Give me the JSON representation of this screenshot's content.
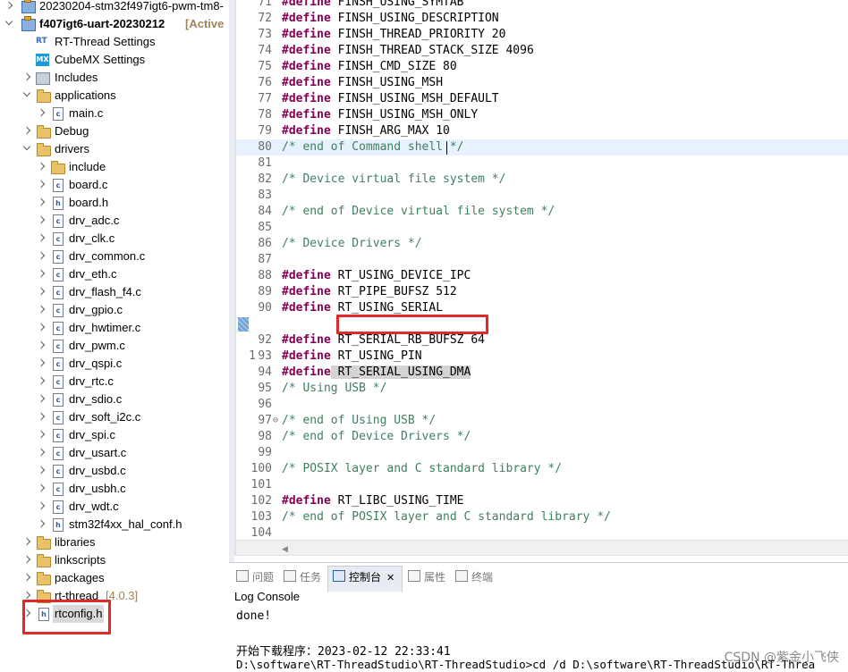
{
  "tree": {
    "project1": {
      "name": "20230204-stm32f497igt6-pwm-tm8-"
    },
    "project2": {
      "name": "f407igt6-uart-20230212",
      "status": "[Active"
    },
    "rtthread_settings": "RT-Thread Settings",
    "cubemx_settings": "CubeMX Settings",
    "includes": "Includes",
    "applications": "applications",
    "main_c": "main.c",
    "debug": "Debug",
    "drivers": "drivers",
    "driver_files": [
      "include",
      "board.c",
      "board.h",
      "drv_adc.c",
      "drv_clk.c",
      "drv_common.c",
      "drv_eth.c",
      "drv_flash_f4.c",
      "drv_gpio.c",
      "drv_hwtimer.c",
      "drv_pwm.c",
      "drv_qspi.c",
      "drv_rtc.c",
      "drv_sdio.c",
      "drv_soft_i2c.c",
      "drv_spi.c",
      "drv_usart.c",
      "drv_usbd.c",
      "drv_usbh.c",
      "drv_wdt.c",
      "stm32f4xx_hal_conf.h"
    ],
    "libraries": "libraries",
    "linkscripts": "linkscripts",
    "packages": "packages",
    "rtthread": "rt-thread",
    "rtthread_version": "[4.0.3]",
    "rtconfig": "rtconfig.h"
  },
  "editor": {
    "lines": [
      {
        "n": "71",
        "kw": "#define",
        "rest": " FINSH_USING_SYMTAB"
      },
      {
        "n": "72",
        "kw": "#define",
        "rest": " FINSH_USING_DESCRIPTION"
      },
      {
        "n": "73",
        "kw": "#define",
        "rest": " FINSH_THREAD_PRIORITY 20"
      },
      {
        "n": "74",
        "kw": "#define",
        "rest": " FINSH_THREAD_STACK_SIZE 4096"
      },
      {
        "n": "75",
        "kw": "#define",
        "rest": " FINSH_CMD_SIZE 80"
      },
      {
        "n": "76",
        "kw": "#define",
        "rest": " FINSH_USING_MSH"
      },
      {
        "n": "77",
        "kw": "#define",
        "rest": " FINSH_USING_MSH_DEFAULT"
      },
      {
        "n": "78",
        "kw": "#define",
        "rest": " FINSH_USING_MSH_ONLY"
      },
      {
        "n": "79",
        "kw": "#define",
        "rest": " FINSH_ARG_MAX 10"
      },
      {
        "n": "80",
        "comment": "/* end of Command shell */"
      },
      {
        "n": "81"
      },
      {
        "n": "82",
        "comment": "/* Device virtual file system */"
      },
      {
        "n": "83"
      },
      {
        "n": "84",
        "comment": "/* end of Device virtual file system */"
      },
      {
        "n": "85"
      },
      {
        "n": "86",
        "comment": "/* Device Drivers */"
      },
      {
        "n": "87"
      },
      {
        "n": "88",
        "kw": "#define",
        "rest": " RT_USING_DEVICE_IPC"
      },
      {
        "n": "89",
        "kw": "#define",
        "rest": " RT_PIPE_BUFSZ 512"
      },
      {
        "n": "90",
        "kw": "#define",
        "rest": " RT_USING_SERIAL"
      },
      {
        "n": "1",
        "kw": "#define",
        "rest": " RT_SERIAL_USING_DMA"
      },
      {
        "n": "92",
        "kw": "#define",
        "rest": " RT_SERIAL_RB_BUFSZ 64"
      },
      {
        "n": "93",
        "kw": "#define",
        "rest": " RT_USING_PIN"
      },
      {
        "n": "94"
      },
      {
        "n": "95",
        "comment": "/* Using USB */"
      },
      {
        "n": "96"
      },
      {
        "n": "97",
        "comment": "/* end of Using USB */"
      },
      {
        "n": "98",
        "comment": "/* end of Device Drivers */"
      },
      {
        "n": "99"
      },
      {
        "n": "100",
        "comment": "/* POSIX layer and C standard library */"
      },
      {
        "n": "101"
      },
      {
        "n": "102",
        "kw": "#define",
        "rest": " RT_LIBC_USING_TIME"
      },
      {
        "n": "103",
        "comment": "/* end of POSIX layer and C standard library */"
      },
      {
        "n": "104"
      }
    ]
  },
  "console": {
    "tabs": [
      "问题",
      "任务",
      "控制台",
      "属性",
      "终端"
    ],
    "active_tab_index": 2,
    "title": "Log Console",
    "output": [
      "done!",
      "",
      "开始下载程序：2023-02-12 22:33:41",
      "D:\\software\\RT-ThreadStudio\\RT-ThreadStudio>cd /d D:\\software\\RT-ThreadStudio\\RT-Threa"
    ]
  },
  "watermark": "CSDN @紫金小飞侠",
  "colors": {
    "keyword": "#7f0055",
    "comment": "#3f7f5f",
    "highlight": "#e02a2a",
    "current_line": "#e8f2fe"
  }
}
